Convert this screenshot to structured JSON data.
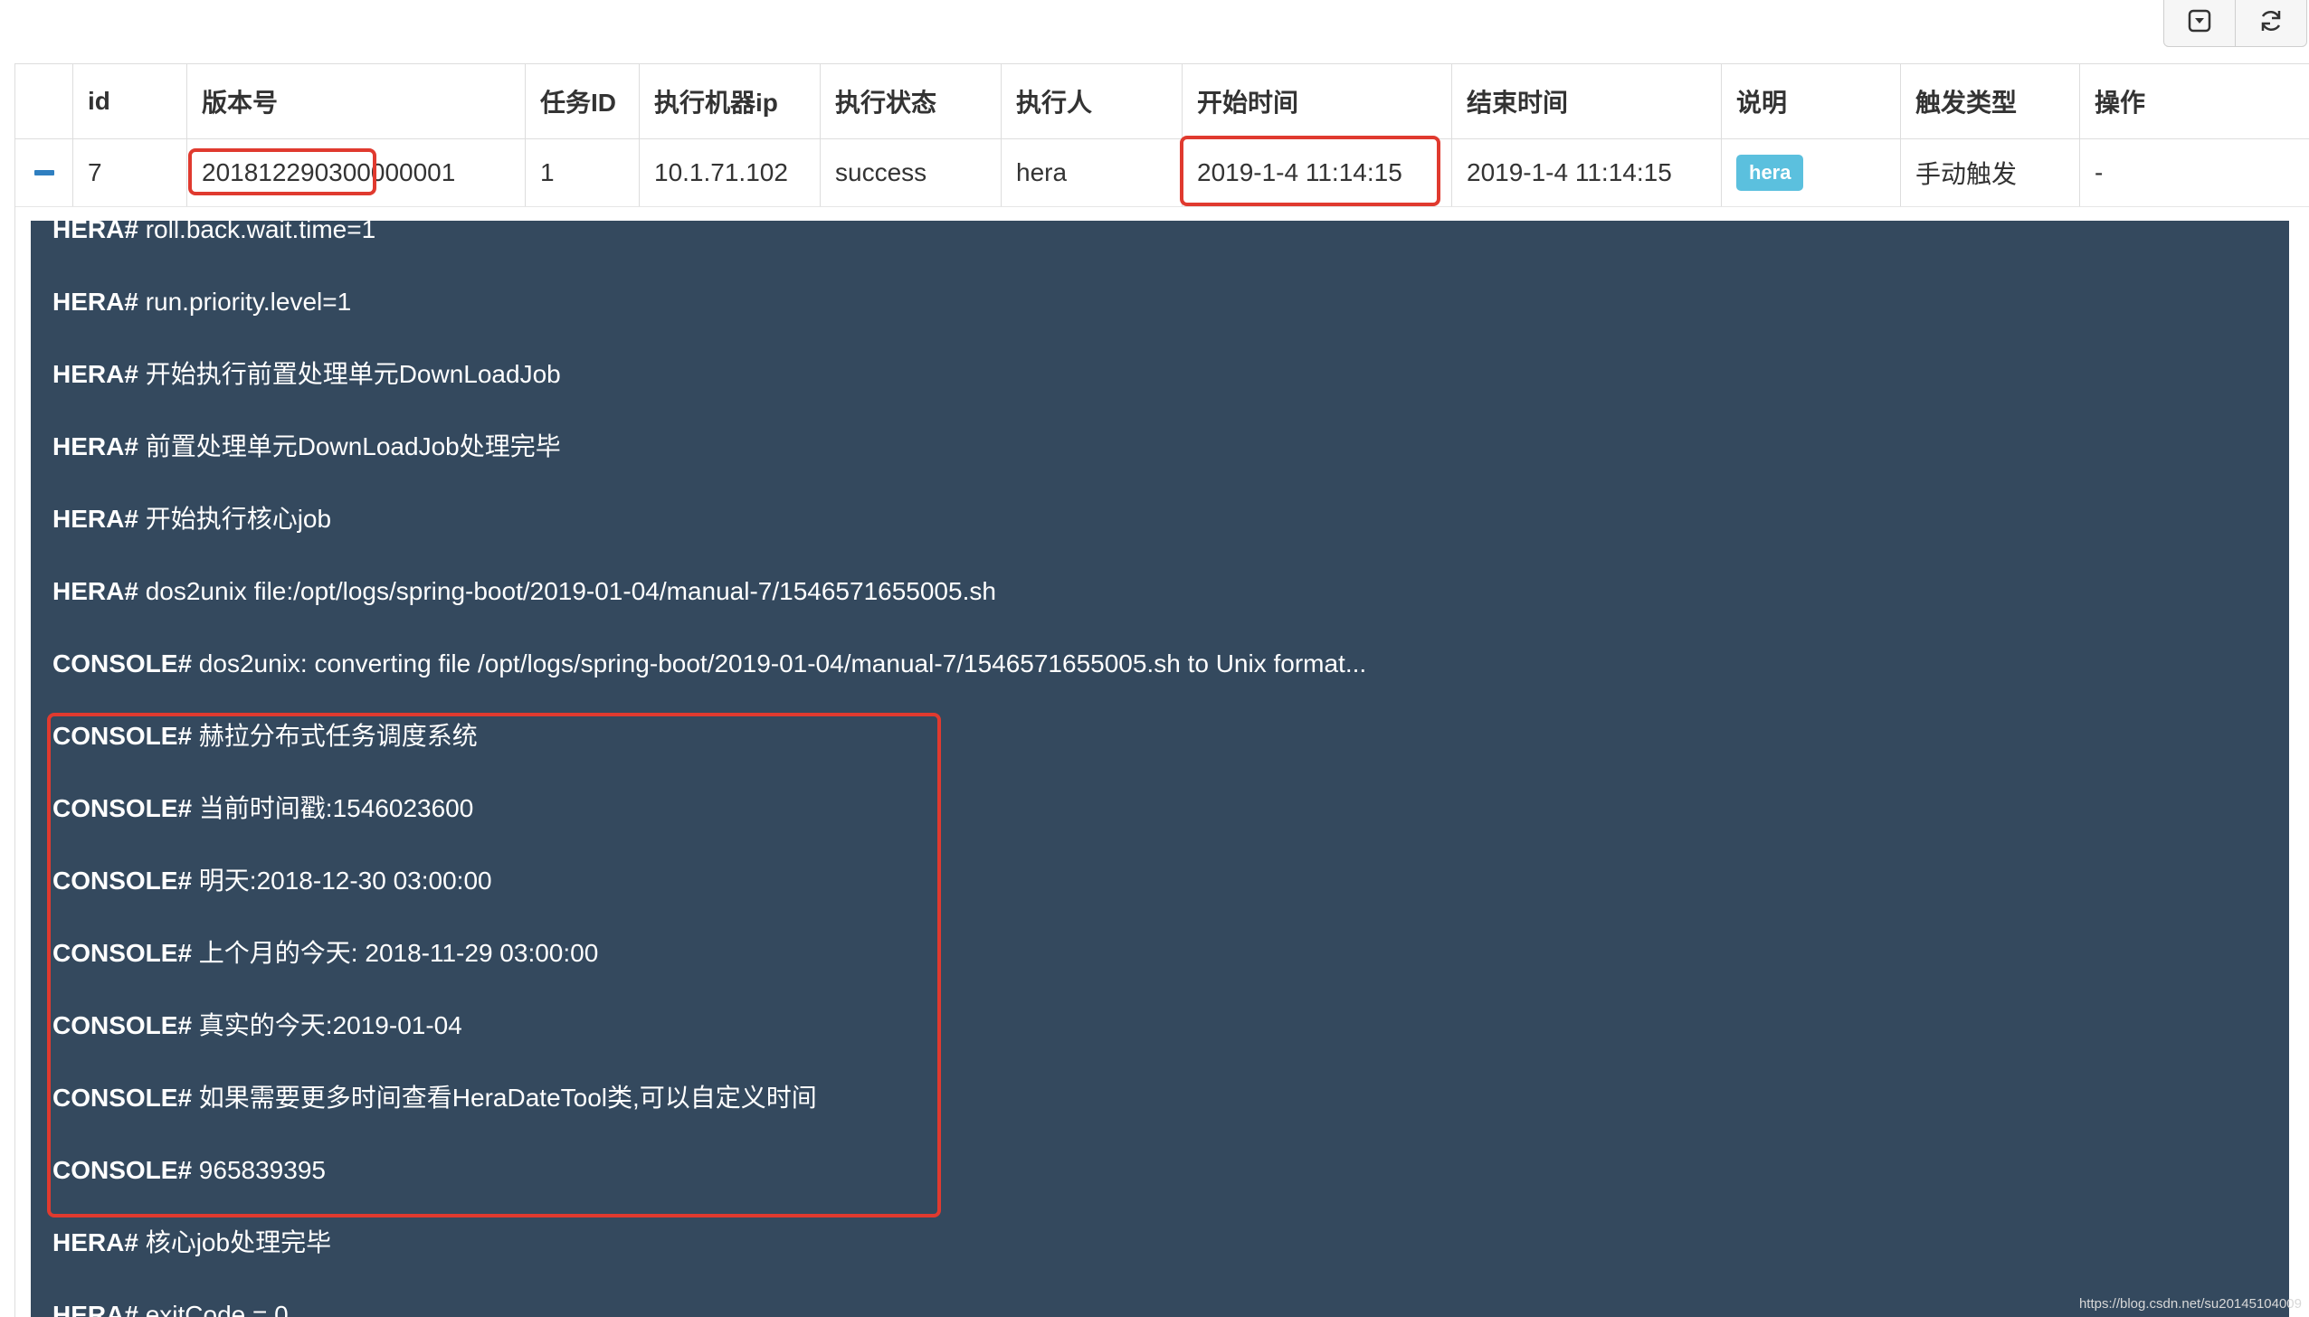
{
  "toolbar": {
    "buttons": [
      {
        "icon": "toggle-view-icon"
      },
      {
        "icon": "refresh-icon"
      }
    ]
  },
  "table": {
    "headers": [
      "",
      "id",
      "版本号",
      "任务ID",
      "执行机器ip",
      "执行状态",
      "执行人",
      "开始时间",
      "结束时间",
      "说明",
      "触发类型",
      "操作"
    ],
    "row": {
      "id": "7",
      "version": "201812290300000001",
      "task_id": "1",
      "machine_ip": "10.1.71.102",
      "status": "success",
      "executor": "hera",
      "start_time": "2019-1-4 11:14:15",
      "end_time": "2019-1-4 11:14:15",
      "description_badge": "hera",
      "trigger_type": "手动触发",
      "action": "-"
    }
  },
  "log": {
    "lines": [
      {
        "prefix": "HERA#",
        "text": " roll.back.wait.time=1"
      },
      {
        "prefix": "HERA#",
        "text": " run.priority.level=1"
      },
      {
        "prefix": "HERA#",
        "text": " 开始执行前置处理单元DownLoadJob"
      },
      {
        "prefix": "HERA#",
        "text": " 前置处理单元DownLoadJob处理完毕"
      },
      {
        "prefix": "HERA#",
        "text": " 开始执行核心job"
      },
      {
        "prefix": "HERA#",
        "text": " dos2unix file:/opt/logs/spring-boot/2019-01-04/manual-7/1546571655005.sh"
      },
      {
        "prefix": "CONSOLE#",
        "text": " dos2unix: converting file /opt/logs/spring-boot/2019-01-04/manual-7/1546571655005.sh to Unix format..."
      },
      {
        "prefix": "CONSOLE#",
        "text": " 赫拉分布式任务调度系统"
      },
      {
        "prefix": "CONSOLE#",
        "text": " 当前时间戳:1546023600"
      },
      {
        "prefix": "CONSOLE#",
        "text": " 明天:2018-12-30 03:00:00"
      },
      {
        "prefix": "CONSOLE#",
        "text": " 上个月的今天: 2018-11-29 03:00:00"
      },
      {
        "prefix": "CONSOLE#",
        "text": " 真实的今天:2019-01-04"
      },
      {
        "prefix": "CONSOLE#",
        "text": " 如果需要更多时间查看HeraDateTool类,可以自定义时间"
      },
      {
        "prefix": "CONSOLE#",
        "text": " 965839395"
      },
      {
        "prefix": "HERA#",
        "text": " 核心job处理完毕"
      },
      {
        "prefix": "HERA#",
        "text": " exitCode = 0"
      }
    ]
  },
  "watermark": "https://blog.csdn.net/su20145104009",
  "colors": {
    "log_background": "#34495e",
    "highlight_red": "#e03a2f",
    "badge": "#5bc0de",
    "toggle_blue": "#2f7fc0"
  }
}
